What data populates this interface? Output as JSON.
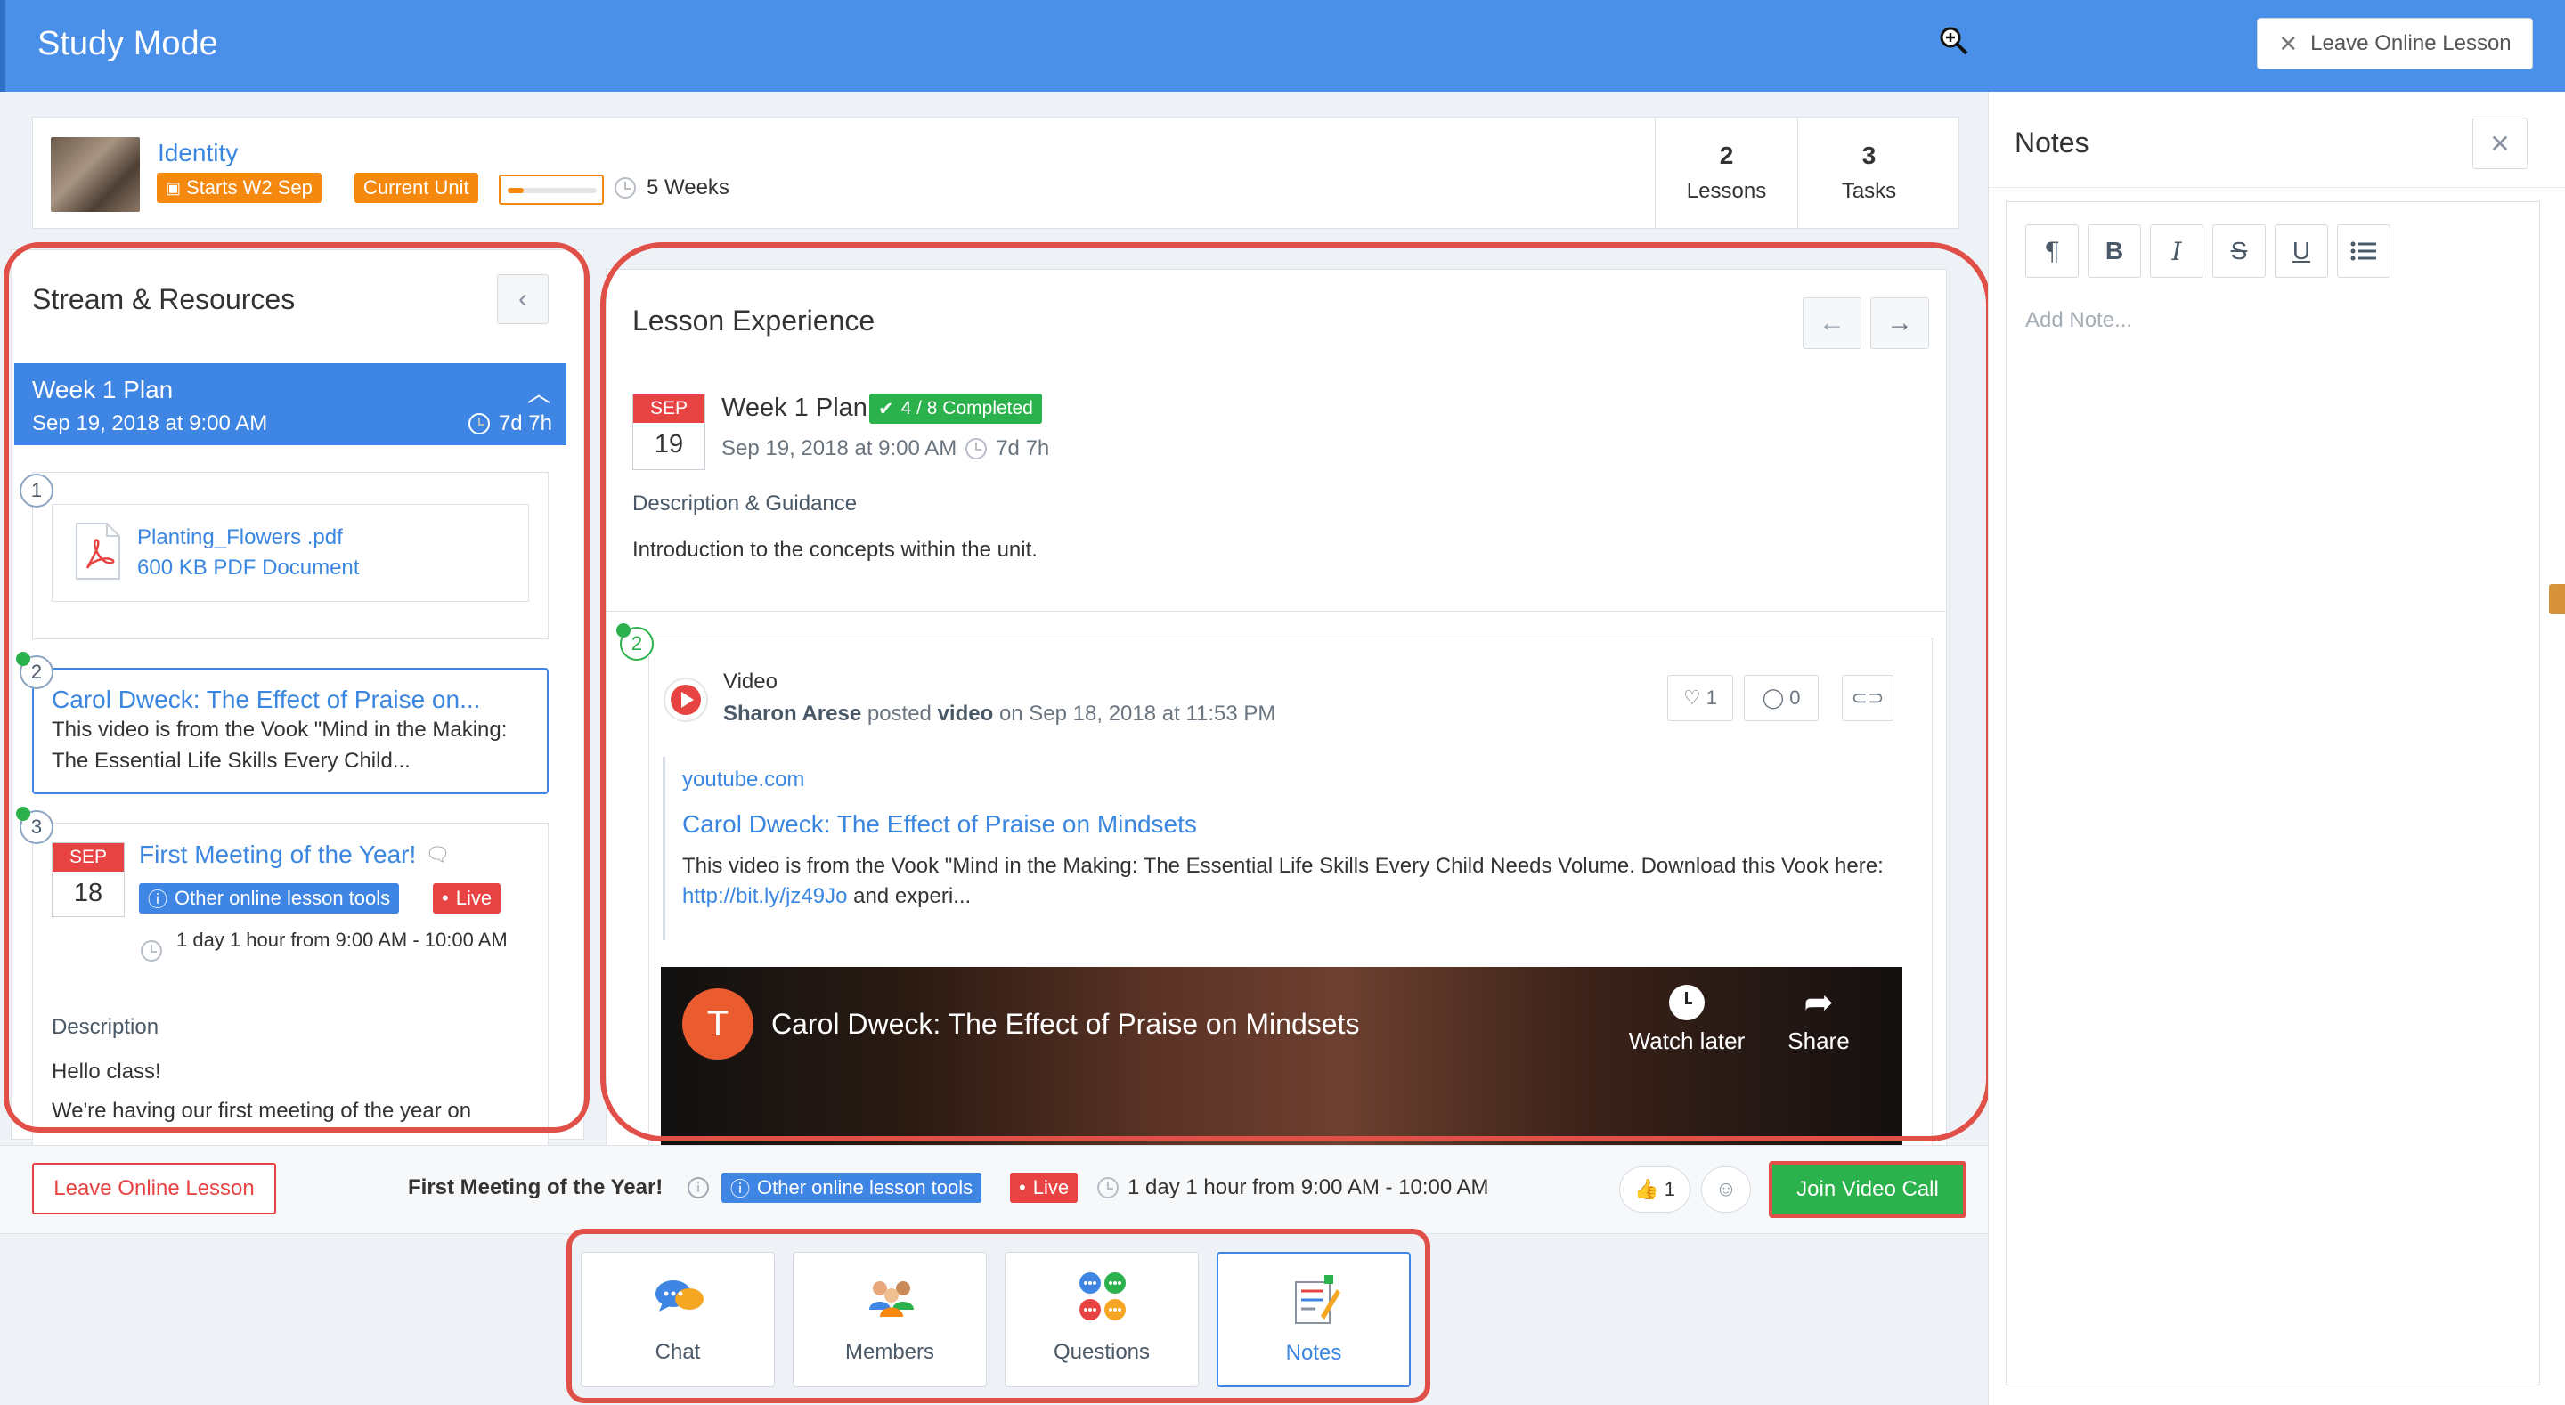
{
  "header": {
    "title": "Study Mode",
    "leave_label": "Leave Online Lesson"
  },
  "unit": {
    "name": "Identity",
    "starts_badge": "Starts W2 Sep",
    "current_badge": "Current Unit",
    "progress": 0.18,
    "duration": "5 Weeks",
    "lessons_count": "2",
    "lessons_label": "Lessons",
    "tasks_count": "3",
    "tasks_label": "Tasks"
  },
  "stream": {
    "title": "Stream & Resources",
    "week": {
      "title": "Week 1 Plan",
      "date": "Sep 19, 2018 at 9:00 AM",
      "remaining": "7d 7h"
    },
    "items": [
      {
        "num": "1",
        "file_name": "Planting_Flowers .pdf",
        "file_meta": "600 KB PDF Document"
      },
      {
        "num": "2",
        "title": "Carol Dweck: The Effect of Praise on...",
        "desc": "This video is from the Vook \"Mind in the Making: The Essential Life Skills Every Child..."
      },
      {
        "num": "3",
        "month": "SEP",
        "day": "18",
        "title": "First Meeting of the Year!",
        "tool": "Other online lesson tools",
        "live": "Live",
        "time": "1 day 1 hour from 9:00 AM - 10:00 AM",
        "desc_label": "Description",
        "line1": "Hello class!",
        "line2": "We're having our first meeting of the year on"
      }
    ]
  },
  "lesson": {
    "title": "Lesson Experience",
    "month": "SEP",
    "day": "19",
    "plan_title": "Week 1 Plan",
    "completed": "4 / 8 Completed",
    "date": "Sep 19, 2018 at 9:00 AM",
    "remaining": "7d 7h",
    "guidance_label": "Description & Guidance",
    "guidance_text": "Introduction to the concepts within the unit.",
    "post": {
      "num": "2",
      "type": "Video",
      "author": "Sharon Arese",
      "posted": "posted",
      "kind": "video",
      "on_date": "on Sep 18, 2018 at 11:53 PM",
      "likes": "1",
      "comments": "0",
      "source": "youtube.com",
      "link_title": "Carol Dweck: The Effect of Praise on Mindsets",
      "desc_start": "This video is from the Vook \"Mind in the Making: The Essential Life Skills Every Child Needs Volume. Download this Vook here: ",
      "desc_link": "http://bit.ly/jz49Jo",
      "desc_end": " and experi...",
      "player_avatar": "T",
      "player_title": "Carol Dweck: The Effect of Praise on Mindsets",
      "watch_later": "Watch later",
      "share": "Share"
    }
  },
  "bottom": {
    "leave_label": "Leave Online Lesson",
    "meeting_title": "First Meeting of the Year!",
    "tool": "Other online lesson tools",
    "live": "Live",
    "time": "1 day 1 hour from 9:00 AM - 10:00 AM",
    "reactions": "1",
    "join_label": "Join Video Call"
  },
  "tabs": [
    {
      "label": "Chat",
      "icon": "chat-icon"
    },
    {
      "label": "Members",
      "icon": "members-icon"
    },
    {
      "label": "Questions",
      "icon": "questions-icon"
    },
    {
      "label": "Notes",
      "icon": "notes-icon",
      "active": true
    }
  ],
  "notes": {
    "title": "Notes",
    "placeholder": "Add Note...",
    "toolbar": [
      "¶",
      "B",
      "I",
      "S",
      "U",
      "list"
    ]
  },
  "colors": {
    "header": "#4a90e8",
    "accent": "#3f86e4",
    "orange": "#f5890f",
    "red": "#e84343",
    "green": "#2bb24c",
    "highlight": "#e05048"
  }
}
